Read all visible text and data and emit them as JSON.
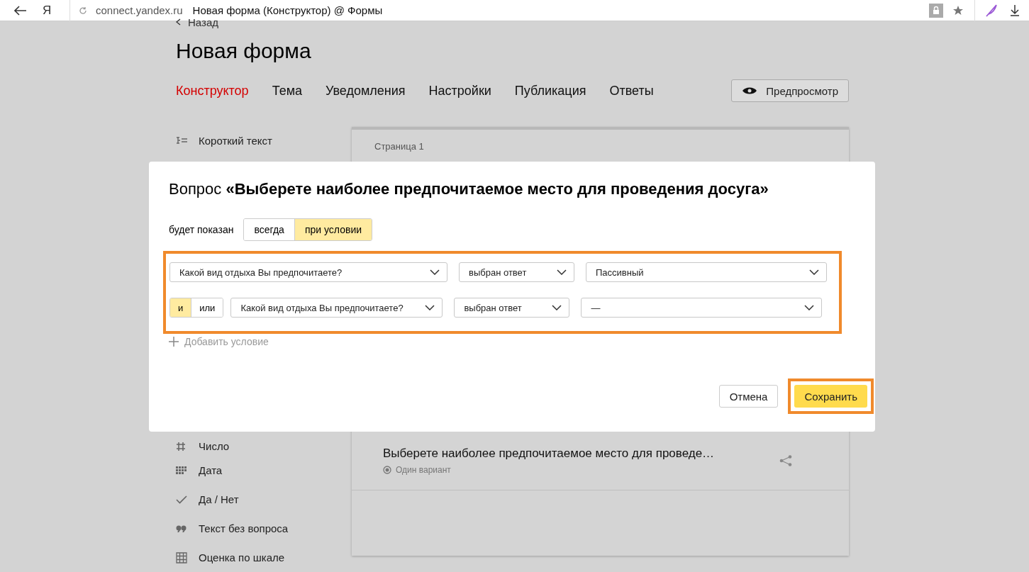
{
  "browser": {
    "logo": "Я",
    "url": "connect.yandex.ru",
    "tab_title": "Новая форма (Конструктор) @ Формы"
  },
  "back_link": "Назад",
  "title": "Новая форма",
  "tabs": [
    {
      "label": "Конструктор",
      "selected": true
    },
    {
      "label": "Тема",
      "selected": false
    },
    {
      "label": "Уведомления",
      "selected": false
    },
    {
      "label": "Настройки",
      "selected": false
    },
    {
      "label": "Публикация",
      "selected": false
    },
    {
      "label": "Ответы",
      "selected": false
    }
  ],
  "preview_button": "Предпросмотр",
  "sidebar": {
    "items": [
      {
        "label": "Короткий текст"
      },
      {
        "label": "Число"
      },
      {
        "label": "Дата"
      },
      {
        "label": "Да / Нет"
      },
      {
        "label": "Текст без вопроса"
      },
      {
        "label": "Оценка по шкале"
      }
    ]
  },
  "card": {
    "page_label": "Страница 1",
    "question": {
      "title": "Выберете наиболее предпочитаемое место для проведе…",
      "type_label": "Один вариант"
    }
  },
  "dialog": {
    "title": "Вопрос **«Выберете наиболее предпочитаемое место для проведения досуга»**",
    "shown_label": "будет показан",
    "visibility_options": [
      {
        "label": "всегда",
        "selected": false
      },
      {
        "label": "при условии",
        "selected": true
      }
    ],
    "conditions_annotated": true,
    "conditions": [
      {
        "question": "Какой вид отдыха Вы предпочитаете?",
        "operator": "выбран ответ",
        "answer": "Пассивный"
      },
      {
        "connectors": [
          {
            "label": "и",
            "selected": true
          },
          {
            "label": "или",
            "selected": false
          }
        ],
        "question": "Какой вид отдыха Вы предпочитаете?",
        "operator": "выбран ответ",
        "answer": "—"
      }
    ],
    "add_condition": "Добавить условие",
    "cancel_button": "Отмена",
    "save_button": {
      "label": "Сохранить",
      "annotated": true
    }
  }
}
